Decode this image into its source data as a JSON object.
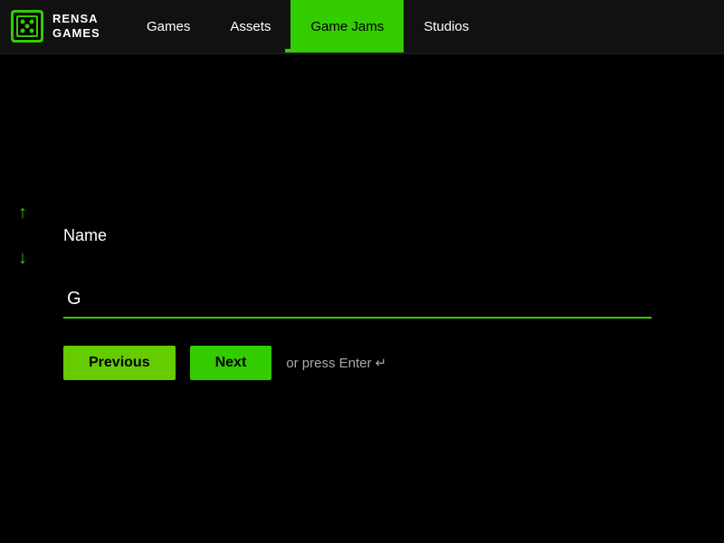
{
  "logo": {
    "line1": "RENSA",
    "line2": "GAMES"
  },
  "nav": {
    "items": [
      {
        "label": "Games",
        "active": false
      },
      {
        "label": "Assets",
        "active": false
      },
      {
        "label": "Game Jams",
        "active": true
      },
      {
        "label": "Studios",
        "active": false
      }
    ]
  },
  "arrows": {
    "up": "↑",
    "down": "↓"
  },
  "form": {
    "field_label": "Name",
    "input_value": "G",
    "input_placeholder": ""
  },
  "buttons": {
    "previous": "Previous",
    "next": "Next",
    "enter_hint": "or press Enter",
    "enter_symbol": "↵"
  },
  "colors": {
    "accent": "#33cc00",
    "accent_light": "#66cc00",
    "bg": "#000000",
    "nav_bg": "#111111",
    "text": "#ffffff",
    "muted": "#aaaaaa"
  }
}
